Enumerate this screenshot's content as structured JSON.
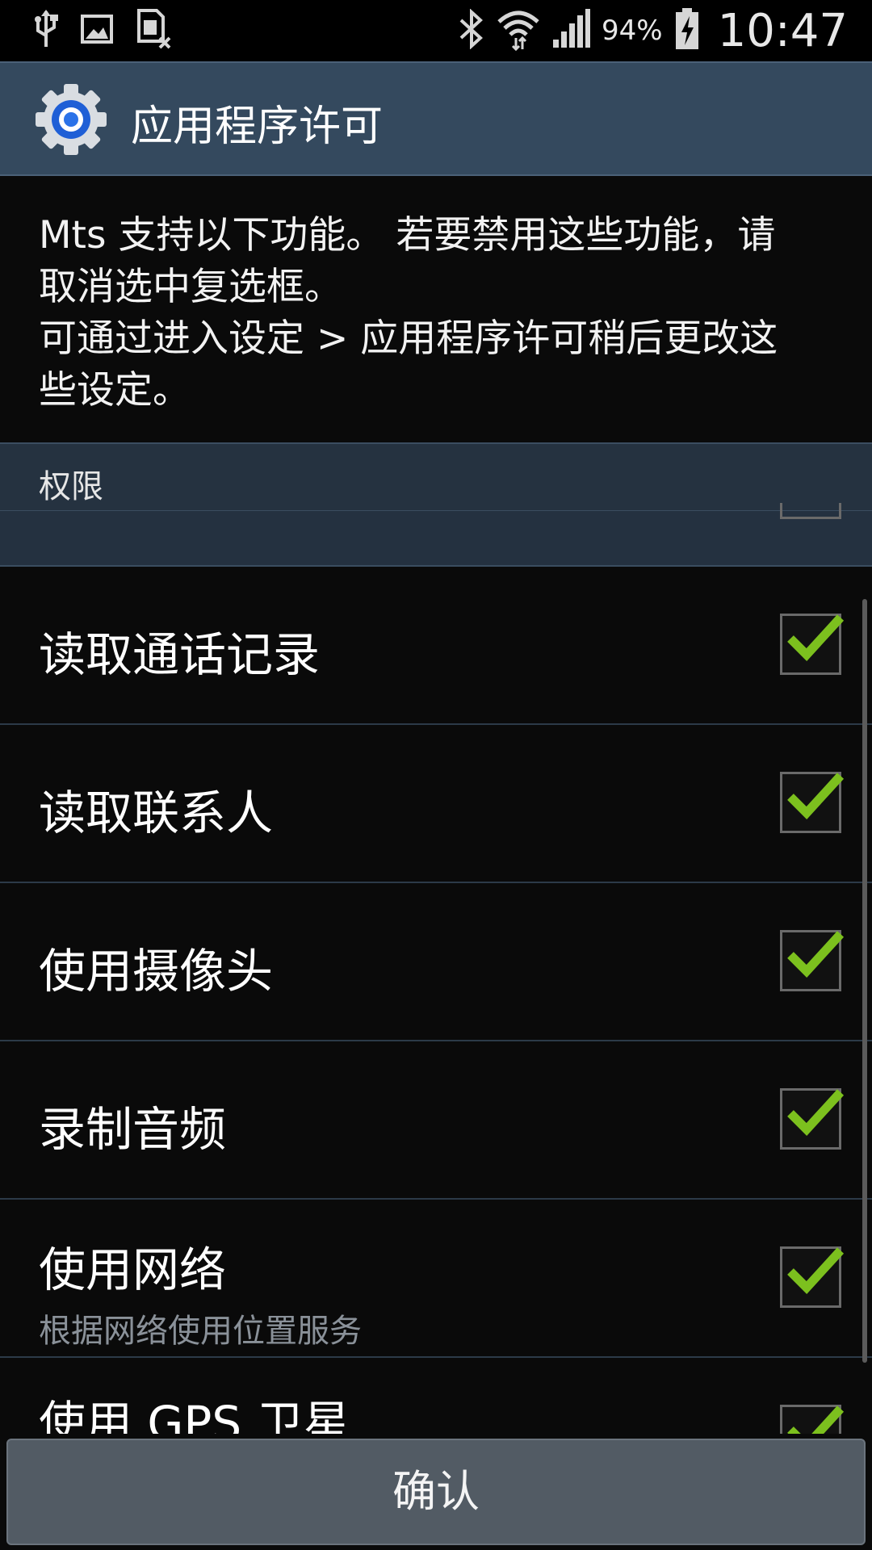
{
  "status_bar": {
    "battery_percent": "94%",
    "time": "10:47",
    "icons": [
      "usb-icon",
      "image-icon",
      "sim-card-icon",
      "bluetooth-icon",
      "wifi-icon",
      "signal-icon",
      "battery-charging-icon"
    ]
  },
  "header": {
    "title": "应用程序许可",
    "icon": "settings-gear-icon"
  },
  "description": "Mts 支持以下功能。 若要禁用这些功能，请\n取消选中复选框。\n可通过进入设定 > 应用程序许可稍后更改这\n些设定。",
  "section": {
    "label": "权限"
  },
  "permissions": [
    {
      "title": "读取通话记录",
      "checked": true
    },
    {
      "title": "读取联系人",
      "checked": true
    },
    {
      "title": "使用摄像头",
      "checked": true
    },
    {
      "title": "录制音频",
      "checked": true
    },
    {
      "title": "使用网络",
      "subtitle": "根据网络使用位置服务",
      "checked": true
    },
    {
      "title": "使用 GPS 卫星",
      "checked": true
    }
  ],
  "confirm_button": {
    "label": "确认"
  },
  "colors": {
    "header_bg": "#34495e",
    "section_bg": "#253240",
    "check_green": "#7cc01e",
    "button_bg": "#525b64"
  }
}
